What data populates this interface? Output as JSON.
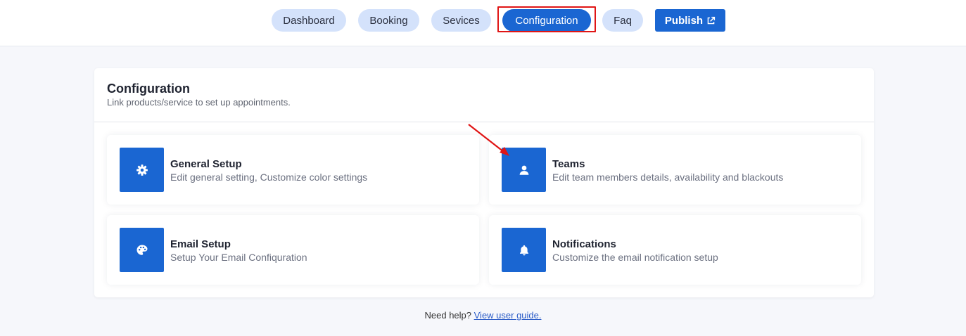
{
  "nav": {
    "items": [
      {
        "label": "Dashboard"
      },
      {
        "label": "Booking"
      },
      {
        "label": "Sevices"
      },
      {
        "label": "Configuration",
        "active": true
      },
      {
        "label": "Faq"
      }
    ],
    "publish_label": "Publish",
    "publish_icon": "external-link-icon"
  },
  "config": {
    "title": "Configuration",
    "subtitle": "Link products/service to set up appointments."
  },
  "tiles": [
    {
      "title": "General Setup",
      "desc": "Edit general setting, Customize color settings",
      "icon": "gear-icon"
    },
    {
      "title": "Teams",
      "desc": "Edit team members details, availability and blackouts",
      "icon": "user-icon"
    },
    {
      "title": "Email Setup",
      "desc": "Setup Your Email Confiquration",
      "icon": "palette-icon"
    },
    {
      "title": "Notifications",
      "desc": "Customize the email notification setup",
      "icon": "bell-icon"
    }
  ],
  "footer": {
    "text": "Need help?",
    "link": "View user guide."
  },
  "colors": {
    "primary": "#1a66d2",
    "pill": "#d4e2fb",
    "highlight": "#e01515"
  }
}
